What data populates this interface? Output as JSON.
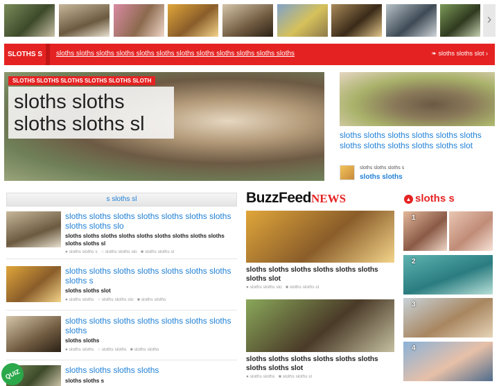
{
  "thumb_strip": {
    "thumbnails": [
      "sloth-thumb-1",
      "sloth-thumb-2",
      "sloth-thumb-3",
      "sloth-thumb-4",
      "sloth-thumb-5",
      "sloth-thumb-6",
      "sloth-thumb-7",
      "sloth-thumb-8",
      "sloth-thumb-9"
    ],
    "next_arrow": "›"
  },
  "red_bar": {
    "label": "SLOTHS S",
    "link": "sloths sloths sloths sloths sloths sloths sloths sloths sloths sloths sloths sloths",
    "twitter": "sloths sloths slot",
    "twitter_arrow": "›"
  },
  "hero": {
    "badge": "SLOTHS SLOTHS SLOTHS SLOTHS SLOTHS SLOTH",
    "title_line1": "sloths sloths",
    "title_line2": "sloths sloths sl"
  },
  "side_story": {
    "title": "sloths sloths sloths sloths sloths sloths sloths sloths sloths sloths sloths slot",
    "meta": "sloths sloths sloths s",
    "author": "sloths sloths"
  },
  "left_column": {
    "header": "s sloths sl",
    "items": [
      {
        "title": "sloths sloths sloths sloths sloths sloths sloths sloths sloths slo",
        "desc": "sloths sloths sloths sloths sloths sloths sloths sloths sloths sloths sloths sl",
        "meta1": "sloths sloths s",
        "meta2": "sloths sloths slo",
        "meta3": "sloths sloths sl"
      },
      {
        "title": "sloths sloths sloths sloths sloths sloths sloths sloths s",
        "desc": "sloths sloths slot",
        "meta1": "sloths sloths",
        "meta2": "sloths sloths slo",
        "meta3": "sloths sloths"
      },
      {
        "title": "sloths sloths sloths sloths sloths sloths sloths sloths",
        "desc": "sloths sloths",
        "meta1": "sloths sloths",
        "meta2": "sloths sloths",
        "meta3": "sloths sloths"
      },
      {
        "title": "sloths sloths sloths sloths",
        "desc": "sloths sloths s"
      }
    ],
    "quiz_badge": "QUIZ"
  },
  "middle_column": {
    "logo_main": "BuzzFeed",
    "logo_news": "NEWS",
    "items": [
      {
        "title": "sloths sloths sloths sloths sloths sloths sloths slot",
        "meta1": "sloths sloths slo",
        "meta2": "sloths sloths sl"
      },
      {
        "title": "sloths sloths sloths sloths sloths sloths sloths sloths slot",
        "meta1": "sloths sloths",
        "meta2": "sloths sloths sl"
      }
    ]
  },
  "right_column": {
    "header": "sloths s",
    "numbers": [
      "1",
      "2",
      "3",
      "4"
    ]
  },
  "colors": {
    "accent_red": "#e52222",
    "link_blue": "#2080d6",
    "quiz_green": "#2aa84a"
  }
}
